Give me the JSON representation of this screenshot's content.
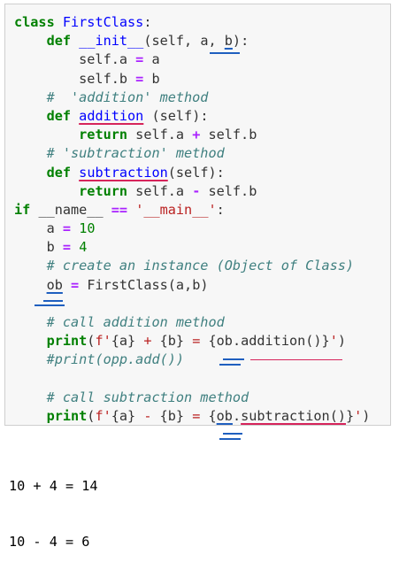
{
  "cell": {
    "code_lines": [
      [
        {
          "t": "class",
          "c": "kw"
        },
        {
          "t": " "
        },
        {
          "t": "FirstClass",
          "c": "def"
        },
        {
          "t": ":"
        }
      ],
      [
        {
          "t": "    "
        },
        {
          "t": "def",
          "c": "kw"
        },
        {
          "t": " "
        },
        {
          "t": "__init__",
          "c": "def"
        },
        {
          "t": "(self, a, "
        },
        {
          "t": "b",
          "u": "blue"
        },
        {
          "t": "):"
        }
      ],
      [
        {
          "t": "        self.a "
        },
        {
          "t": "=",
          "c": "op"
        },
        {
          "t": " a"
        }
      ],
      [
        {
          "t": "        self.b "
        },
        {
          "t": "=",
          "c": "op"
        },
        {
          "t": " b"
        }
      ],
      [
        {
          "t": "    "
        },
        {
          "t": "#  'addition' method",
          "c": "cm"
        }
      ],
      [
        {
          "t": "    "
        },
        {
          "t": "def",
          "c": "kw"
        },
        {
          "t": " "
        },
        {
          "t": "addition",
          "c": "def",
          "u": "red"
        },
        {
          "t": " (self):"
        }
      ],
      [
        {
          "t": "        "
        },
        {
          "t": "return",
          "c": "kw"
        },
        {
          "t": " self.a "
        },
        {
          "t": "+",
          "c": "op"
        },
        {
          "t": " self.b"
        }
      ],
      [
        {
          "t": "    "
        },
        {
          "t": "# 'subtraction' method",
          "c": "cm"
        }
      ],
      [
        {
          "t": "    "
        },
        {
          "t": "def",
          "c": "kw"
        },
        {
          "t": " "
        },
        {
          "t": "subtraction",
          "c": "def",
          "u": "red"
        },
        {
          "t": "(self):"
        }
      ],
      [
        {
          "t": "        "
        },
        {
          "t": "return",
          "c": "kw"
        },
        {
          "t": " self.a "
        },
        {
          "t": "-",
          "c": "op"
        },
        {
          "t": " self.b"
        }
      ],
      [
        {
          "t": "if",
          "c": "kw"
        },
        {
          "t": " __name__ "
        },
        {
          "t": "==",
          "c": "op"
        },
        {
          "t": " "
        },
        {
          "t": "'__main__'",
          "c": "str"
        },
        {
          "t": ":"
        }
      ],
      [
        {
          "t": "    a "
        },
        {
          "t": "=",
          "c": "op"
        },
        {
          "t": " "
        },
        {
          "t": "10",
          "c": "num"
        }
      ],
      [
        {
          "t": "    b "
        },
        {
          "t": "=",
          "c": "op"
        },
        {
          "t": " "
        },
        {
          "t": "4",
          "c": "num"
        }
      ],
      [
        {
          "t": "    "
        },
        {
          "t": "# create an instance (Object of Class)",
          "c": "cm"
        }
      ],
      [
        {
          "t": "    "
        },
        {
          "t": "ob",
          "u": "blue"
        },
        {
          "t": " "
        },
        {
          "t": "=",
          "c": "op"
        },
        {
          "t": " FirstClass(a,b)"
        }
      ],
      [
        {
          "t": ""
        }
      ],
      [
        {
          "t": "    "
        },
        {
          "t": "# call addition method",
          "c": "cm"
        }
      ],
      [
        {
          "t": "    "
        },
        {
          "t": "print",
          "c": "kw"
        },
        {
          "t": "("
        },
        {
          "t": "f'",
          "c": "str"
        },
        {
          "t": "{a}"
        },
        {
          "t": " + ",
          "c": "str"
        },
        {
          "t": "{b}"
        },
        {
          "t": " = ",
          "c": "str"
        },
        {
          "t": "{"
        },
        {
          "t": "ob",
          "c": "pl"
        },
        {
          "t": "."
        },
        {
          "t": "addition()"
        },
        {
          "t": "}"
        },
        {
          "t": "'",
          "c": "str"
        },
        {
          "t": ")"
        }
      ],
      [
        {
          "t": "    "
        },
        {
          "t": "#print(opp.add())",
          "c": "cm"
        }
      ],
      [
        {
          "t": ""
        }
      ],
      [
        {
          "t": "    "
        },
        {
          "t": "# call subtraction method",
          "c": "cm"
        }
      ],
      [
        {
          "t": "    "
        },
        {
          "t": "print",
          "c": "kw"
        },
        {
          "t": "("
        },
        {
          "t": "f'",
          "c": "str"
        },
        {
          "t": "{a}"
        },
        {
          "t": " - ",
          "c": "str"
        },
        {
          "t": "{b}"
        },
        {
          "t": " = ",
          "c": "str"
        },
        {
          "t": "{"
        },
        {
          "t": "ob",
          "u": "blue"
        },
        {
          "t": "."
        },
        {
          "t": "subtraction()",
          "u": "red"
        },
        {
          "t": "}"
        },
        {
          "t": "'",
          "c": "str"
        },
        {
          "t": ")"
        }
      ]
    ]
  },
  "output": {
    "lines": [
      "10 + 4 = 14",
      "10 - 4 = 6"
    ]
  },
  "colors": {
    "keyword": "#008000",
    "definition": "#0000ff",
    "operator": "#aa22ff",
    "comment": "#408080",
    "string": "#ba2121",
    "annotation_blue": "#1f5fbf",
    "annotation_red": "#d6245b"
  }
}
